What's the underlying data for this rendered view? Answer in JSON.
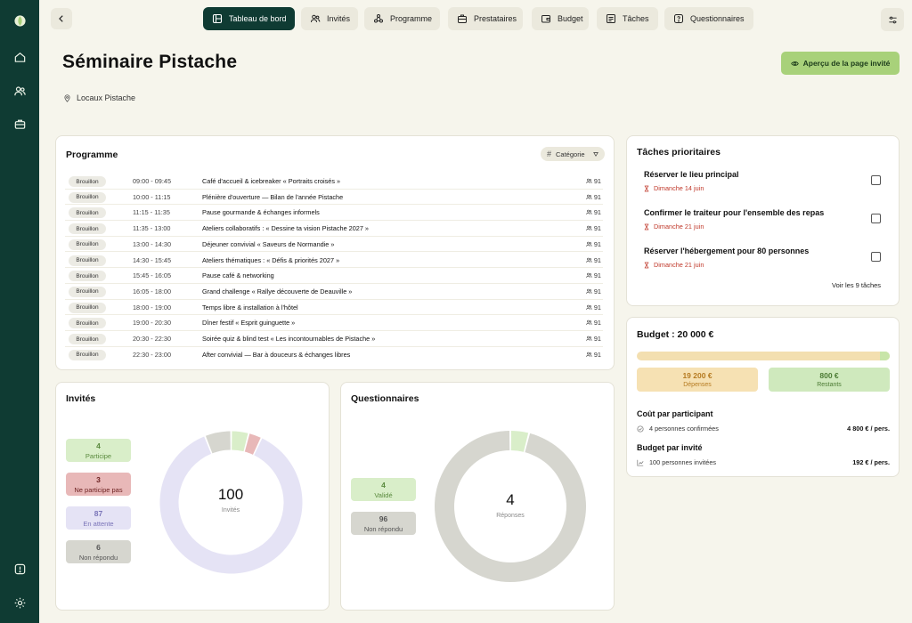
{
  "nav": {
    "items": [
      {
        "label": "Tableau de bord",
        "icon": "layout-icon",
        "active": true
      },
      {
        "label": "Invités",
        "icon": "users-icon"
      },
      {
        "label": "Programme",
        "icon": "program-icon"
      },
      {
        "label": "Prestataires",
        "icon": "briefcase-icon"
      },
      {
        "label": "Budget",
        "icon": "wallet-icon"
      },
      {
        "label": "Tâches",
        "icon": "tasks-icon"
      },
      {
        "label": "Questionnaires",
        "icon": "form-icon"
      }
    ]
  },
  "header": {
    "title": "Séminaire Pistache",
    "location": "Locaux Pistache",
    "preview_label": "Aperçu de la page invité"
  },
  "programme": {
    "title": "Programme",
    "filter_label": "Catégorie",
    "rows": [
      {
        "status": "Brouillon",
        "time": "09:00 - 09:45",
        "name": "Café d'accueil & icebreaker « Portraits croisés »",
        "count": "91"
      },
      {
        "status": "Brouillon",
        "time": "10:00 - 11:15",
        "name": "Plénière d'ouverture — Bilan de l'année Pistache",
        "count": "91"
      },
      {
        "status": "Brouillon",
        "time": "11:15 - 11:35",
        "name": "Pause gourmande & échanges informels",
        "count": "91"
      },
      {
        "status": "Brouillon",
        "time": "11:35 - 13:00",
        "name": "Ateliers collaboratifs : « Dessine ta vision Pistache 2027 »",
        "count": "91"
      },
      {
        "status": "Brouillon",
        "time": "13:00 - 14:30",
        "name": "Déjeuner convivial « Saveurs de Normandie »",
        "count": "91"
      },
      {
        "status": "Brouillon",
        "time": "14:30 - 15:45",
        "name": "Ateliers thématiques : « Défis & priorités 2027 »",
        "count": "91"
      },
      {
        "status": "Brouillon",
        "time": "15:45 - 16:05",
        "name": "Pause café & networking",
        "count": "91"
      },
      {
        "status": "Brouillon",
        "time": "16:05 - 18:00",
        "name": "Grand challenge « Rallye découverte de Deauville »",
        "count": "91"
      },
      {
        "status": "Brouillon",
        "time": "18:00 - 19:00",
        "name": "Temps libre & installation à l'hôtel",
        "count": "91"
      },
      {
        "status": "Brouillon",
        "time": "19:00 - 20:30",
        "name": "Dîner festif « Esprit guinguette »",
        "count": "91"
      },
      {
        "status": "Brouillon",
        "time": "20:30 - 22:30",
        "name": "Soirée quiz & blind test « Les incontournables de Pistache »",
        "count": "91"
      },
      {
        "status": "Brouillon",
        "time": "22:30 - 23:00",
        "name": "After convivial — Bar à douceurs & échanges libres",
        "count": "91"
      }
    ]
  },
  "tasks": {
    "title": "Tâches prioritaires",
    "items": [
      {
        "title": "Réserver le lieu principal",
        "date": "Dimanche 14 juin"
      },
      {
        "title": "Confirmer le traiteur pour l'ensemble des repas",
        "date": "Dimanche 21 juin"
      },
      {
        "title": "Réserver l'hébergement pour 80 personnes",
        "date": "Dimanche 21 juin"
      }
    ],
    "see_all": "Voir les 9 tâches"
  },
  "budget": {
    "title": "Budget : 20 000 €",
    "spent_fraction": 0.96,
    "spent_value": "19 200 €",
    "spent_label": "Dépenses",
    "remaining_value": "800 €",
    "remaining_label": "Restants",
    "per_participant_title": "Coût par participant",
    "per_participant_desc": "4 personnes confirmées",
    "per_participant_value": "4 800 € / pers.",
    "per_invite_title": "Budget par invité",
    "per_invite_desc": "100 personnes invitées",
    "per_invite_value": "192 € / pers."
  },
  "guests": {
    "title": "Invités",
    "total": "100",
    "total_label": "Invités",
    "legend": [
      {
        "value": "4",
        "label": "Participe",
        "color": "#d9eec9",
        "text": "#5a8a3e"
      },
      {
        "value": "3",
        "label": "Ne participe pas",
        "color": "#e8b8b8",
        "text": "#6b1f1f"
      },
      {
        "value": "87",
        "label": "En attente",
        "color": "#e5e3f5",
        "text": "#7a74b8"
      },
      {
        "value": "6",
        "label": "Non répondu",
        "color": "#d6d6cf",
        "text": "#555"
      }
    ],
    "chart_data": {
      "type": "pie",
      "values": [
        4,
        3,
        87,
        6
      ],
      "colors": [
        "#d9eec9",
        "#e8b8b8",
        "#e5e3f5",
        "#d6d6cf"
      ]
    }
  },
  "questionnaires": {
    "title": "Questionnaires",
    "total": "4",
    "total_label": "Réponses",
    "legend": [
      {
        "value": "4",
        "label": "Validé",
        "color": "#d9eec9",
        "text": "#5a8a3e"
      },
      {
        "value": "96",
        "label": "Non répondu",
        "color": "#d6d6cf",
        "text": "#555"
      }
    ],
    "chart_data": {
      "type": "pie",
      "values": [
        4,
        96
      ],
      "colors": [
        "#d9eec9",
        "#d6d6cf"
      ]
    }
  }
}
